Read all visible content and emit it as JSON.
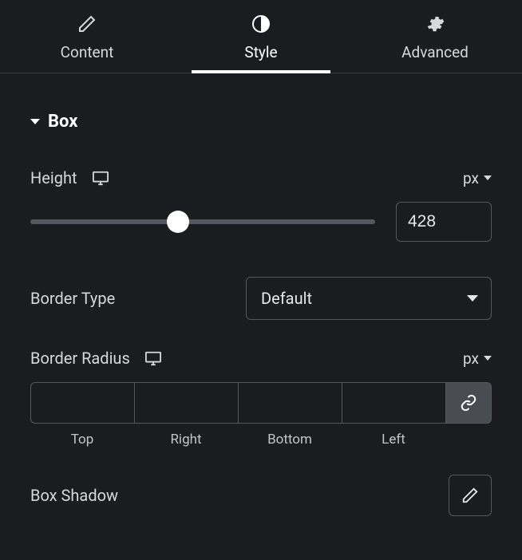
{
  "tabs": {
    "content": "Content",
    "style": "Style",
    "advanced": "Advanced",
    "active": "style"
  },
  "section": {
    "title": "Box"
  },
  "height": {
    "label": "Height",
    "unit": "px",
    "value": "428",
    "slider_percent": 42.8
  },
  "border_type": {
    "label": "Border Type",
    "value": "Default"
  },
  "border_radius": {
    "label": "Border Radius",
    "unit": "px",
    "sides": {
      "top": "Top",
      "right": "Right",
      "bottom": "Bottom",
      "left": "Left"
    },
    "values": {
      "top": "",
      "right": "",
      "bottom": "",
      "left": ""
    }
  },
  "box_shadow": {
    "label": "Box Shadow"
  }
}
